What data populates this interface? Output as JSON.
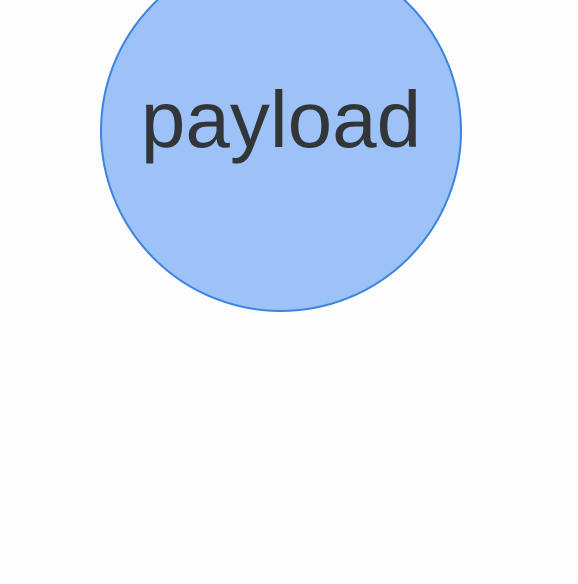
{
  "diagram": {
    "node": {
      "label": "payload",
      "fill_color": "#9cc2f7",
      "border_color": "#3d83e0",
      "text_color": "#323639"
    },
    "background_color": "#fdfdfd"
  }
}
